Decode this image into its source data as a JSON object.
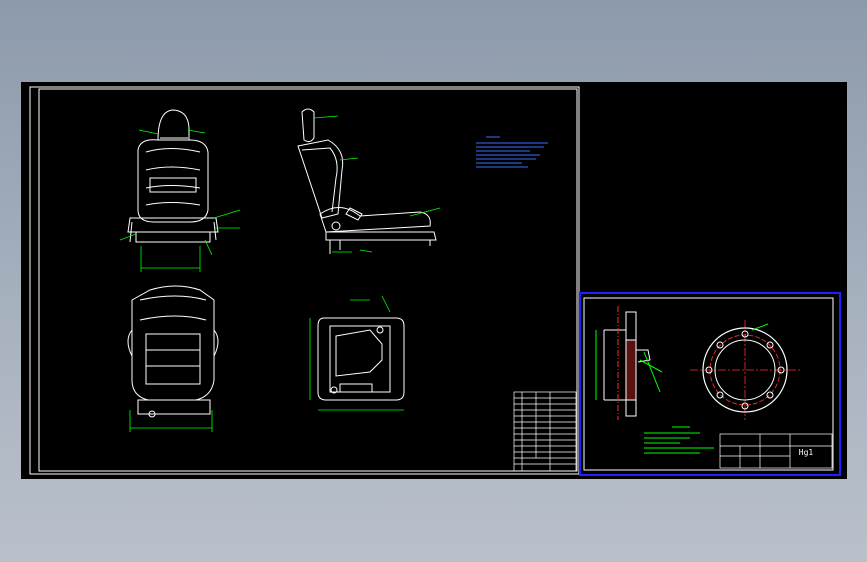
{
  "sheet_main": {
    "views": [
      "front-view",
      "side-view",
      "rear-view",
      "bottom-view"
    ],
    "notes_block": {
      "color": "#3a6cff"
    },
    "title_block": {
      "rows": 12,
      "cols": 4
    }
  },
  "sheet_detail": {
    "frame_color": "#2020ff",
    "title_block": {
      "right_label": "Hg1",
      "mid_label": ""
    }
  },
  "colors": {
    "line": "#ffffff",
    "dim": "#00ff00",
    "center": "#ff2a2a",
    "hatch": "#ff3333",
    "annotation": "#3a6cff"
  }
}
